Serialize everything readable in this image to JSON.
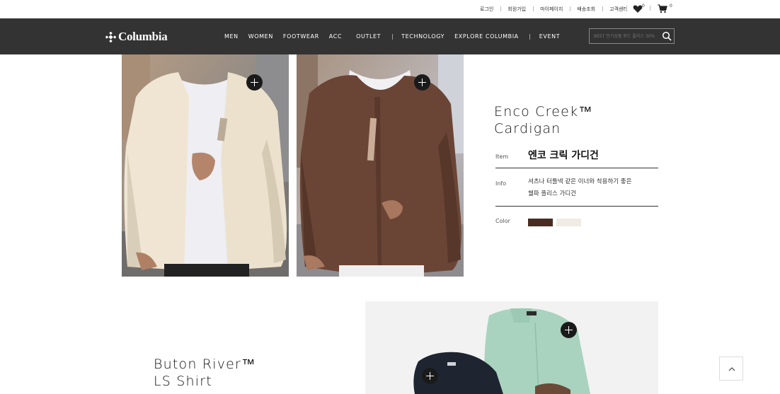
{
  "util": {
    "links": [
      "로그인",
      "회원가입",
      "마이페이지",
      "배송조회",
      "고객센터"
    ],
    "wishlist_count": "0",
    "cart_count": "0"
  },
  "nav": {
    "logo": "Columbia",
    "menu": [
      "MEN",
      "WOMEN",
      "FOOTWEAR",
      "ACC",
      "OUTLET",
      "TECHNOLOGY",
      "EXPLORE COLUMBIA",
      "EVENT"
    ],
    "search_placeholder": "BEST 인기상품 후드 플리스 30%"
  },
  "product1": {
    "name_line1": "Enco Creek™",
    "name_line2": "Cardigan",
    "item_label": "Item",
    "item_value": "엔코 크릭 가디건",
    "info_label": "Info",
    "info_line1": "셔츠나 터틀넥 같은 이너와 착용하기 좋은",
    "info_line2": "쉘파 플리스 가디건",
    "color_label": "Color",
    "colors": [
      "#4a2c21",
      "#f1ece3"
    ]
  },
  "product2": {
    "name_line1": "Buton River™",
    "name_line2": "LS Shirt"
  },
  "colors": {
    "nav_bg": "#333333",
    "accent_dark": "#1a1a1a"
  }
}
